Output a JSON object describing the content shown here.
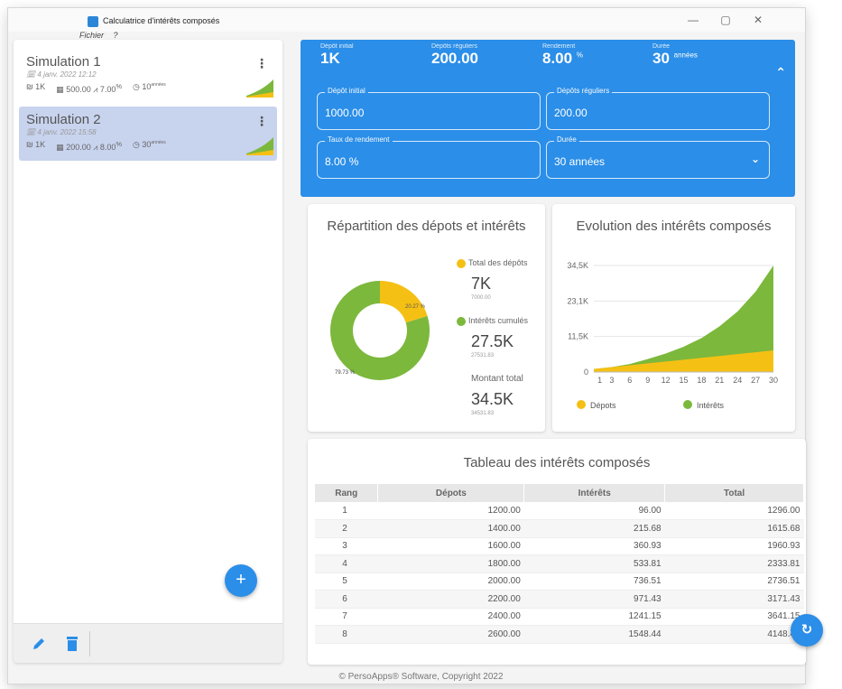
{
  "app": {
    "title": "Calculatrice d'intérêts composés",
    "menu": [
      "Fichier",
      "?"
    ],
    "controls": {
      "minimize": "—",
      "maximize": "▢",
      "close": "✕"
    }
  },
  "simulations": [
    {
      "name": "Simulation 1",
      "date": "4 janv. 2022 12:12",
      "deposit": "1K",
      "regular": "500.00",
      "rate": "7.00",
      "rate_unit": "%",
      "duration": "10",
      "duration_unit": "années"
    },
    {
      "name": "Simulation 2",
      "date": "4 janv. 2022 15:58",
      "deposit": "1K",
      "regular": "200.00",
      "rate": "8.00",
      "rate_unit": "%",
      "duration": "30",
      "duration_unit": "années"
    }
  ],
  "sidebar_actions": {
    "add": "+"
  },
  "summary": {
    "initial_label": "Dépôt initial",
    "initial_value": "1K",
    "regular_label": "Dépôts réguliers",
    "regular_value": "200.00",
    "rate_label": "Rendement",
    "rate_value": "8.00",
    "rate_unit": "%",
    "duration_label": "Durée",
    "duration_value": "30",
    "duration_unit": "années"
  },
  "fields": {
    "initial": {
      "label": "Dépôt initial",
      "value": "1000.00"
    },
    "regular": {
      "label": "Dépôts réguliers",
      "value": "200.00"
    },
    "rate": {
      "label": "Taux de rendement",
      "value": "8.00 %"
    },
    "duration": {
      "label": "Durée",
      "value": "30 années"
    }
  },
  "donut": {
    "title": "Répartition des dépots et intérêts",
    "deposits_label": "Total des dépôts",
    "deposits_big": "7K",
    "deposits_exact": "7000.00",
    "interest_label": "Intérêts cumulés",
    "interest_big": "27.5K",
    "interest_exact": "27531.83",
    "total_label": "Montant total",
    "total_big": "34.5K",
    "total_exact": "34531.83",
    "pct_deposits": "20.27 %",
    "pct_interest": "79.73 %",
    "fraction_deposits": 0.2027,
    "colors": {
      "deposits": "#f5c014",
      "interest": "#7cb83c"
    }
  },
  "chart_data": {
    "type": "area",
    "title": "Evolution des intérêts composés",
    "xlim": [
      0,
      30
    ],
    "ylim": [
      0,
      34.5
    ],
    "yticks": [
      "0",
      "11,5K",
      "23,1K",
      "34,5K"
    ],
    "xticks": [
      "1",
      "3",
      "6",
      "9",
      "12",
      "15",
      "18",
      "21",
      "24",
      "27",
      "30"
    ],
    "x": [
      0,
      3,
      6,
      9,
      12,
      15,
      18,
      21,
      24,
      27,
      30
    ],
    "series": [
      {
        "name": "Dépots",
        "color": "#f5c014",
        "values": [
          1.0,
          1.6,
          2.2,
          2.8,
          3.4,
          4.0,
          4.6,
          5.2,
          5.8,
          6.4,
          7.0
        ]
      },
      {
        "name": "Intérêts",
        "color": "#7cb83c",
        "values": [
          1.0,
          1.6,
          2.6,
          4.2,
          6.0,
          8.2,
          11.0,
          14.8,
          19.6,
          26.0,
          34.5
        ]
      }
    ],
    "legend_position": "bottom"
  },
  "table": {
    "title": "Tableau des intérêts composés",
    "headers": [
      "Rang",
      "Dépots",
      "Intérêts",
      "Total"
    ],
    "rows": [
      [
        "1",
        "1200.00",
        "96.00",
        "1296.00"
      ],
      [
        "2",
        "1400.00",
        "215.68",
        "1615.68"
      ],
      [
        "3",
        "1600.00",
        "360.93",
        "1960.93"
      ],
      [
        "4",
        "1800.00",
        "533.81",
        "2333.81"
      ],
      [
        "5",
        "2000.00",
        "736.51",
        "2736.51"
      ],
      [
        "6",
        "2200.00",
        "971.43",
        "3171.43"
      ],
      [
        "7",
        "2400.00",
        "1241.15",
        "3641.15"
      ],
      [
        "8",
        "2600.00",
        "1548.44",
        "4148.44"
      ]
    ]
  },
  "footer": "© PersoApps® Software, Copyright 2022"
}
